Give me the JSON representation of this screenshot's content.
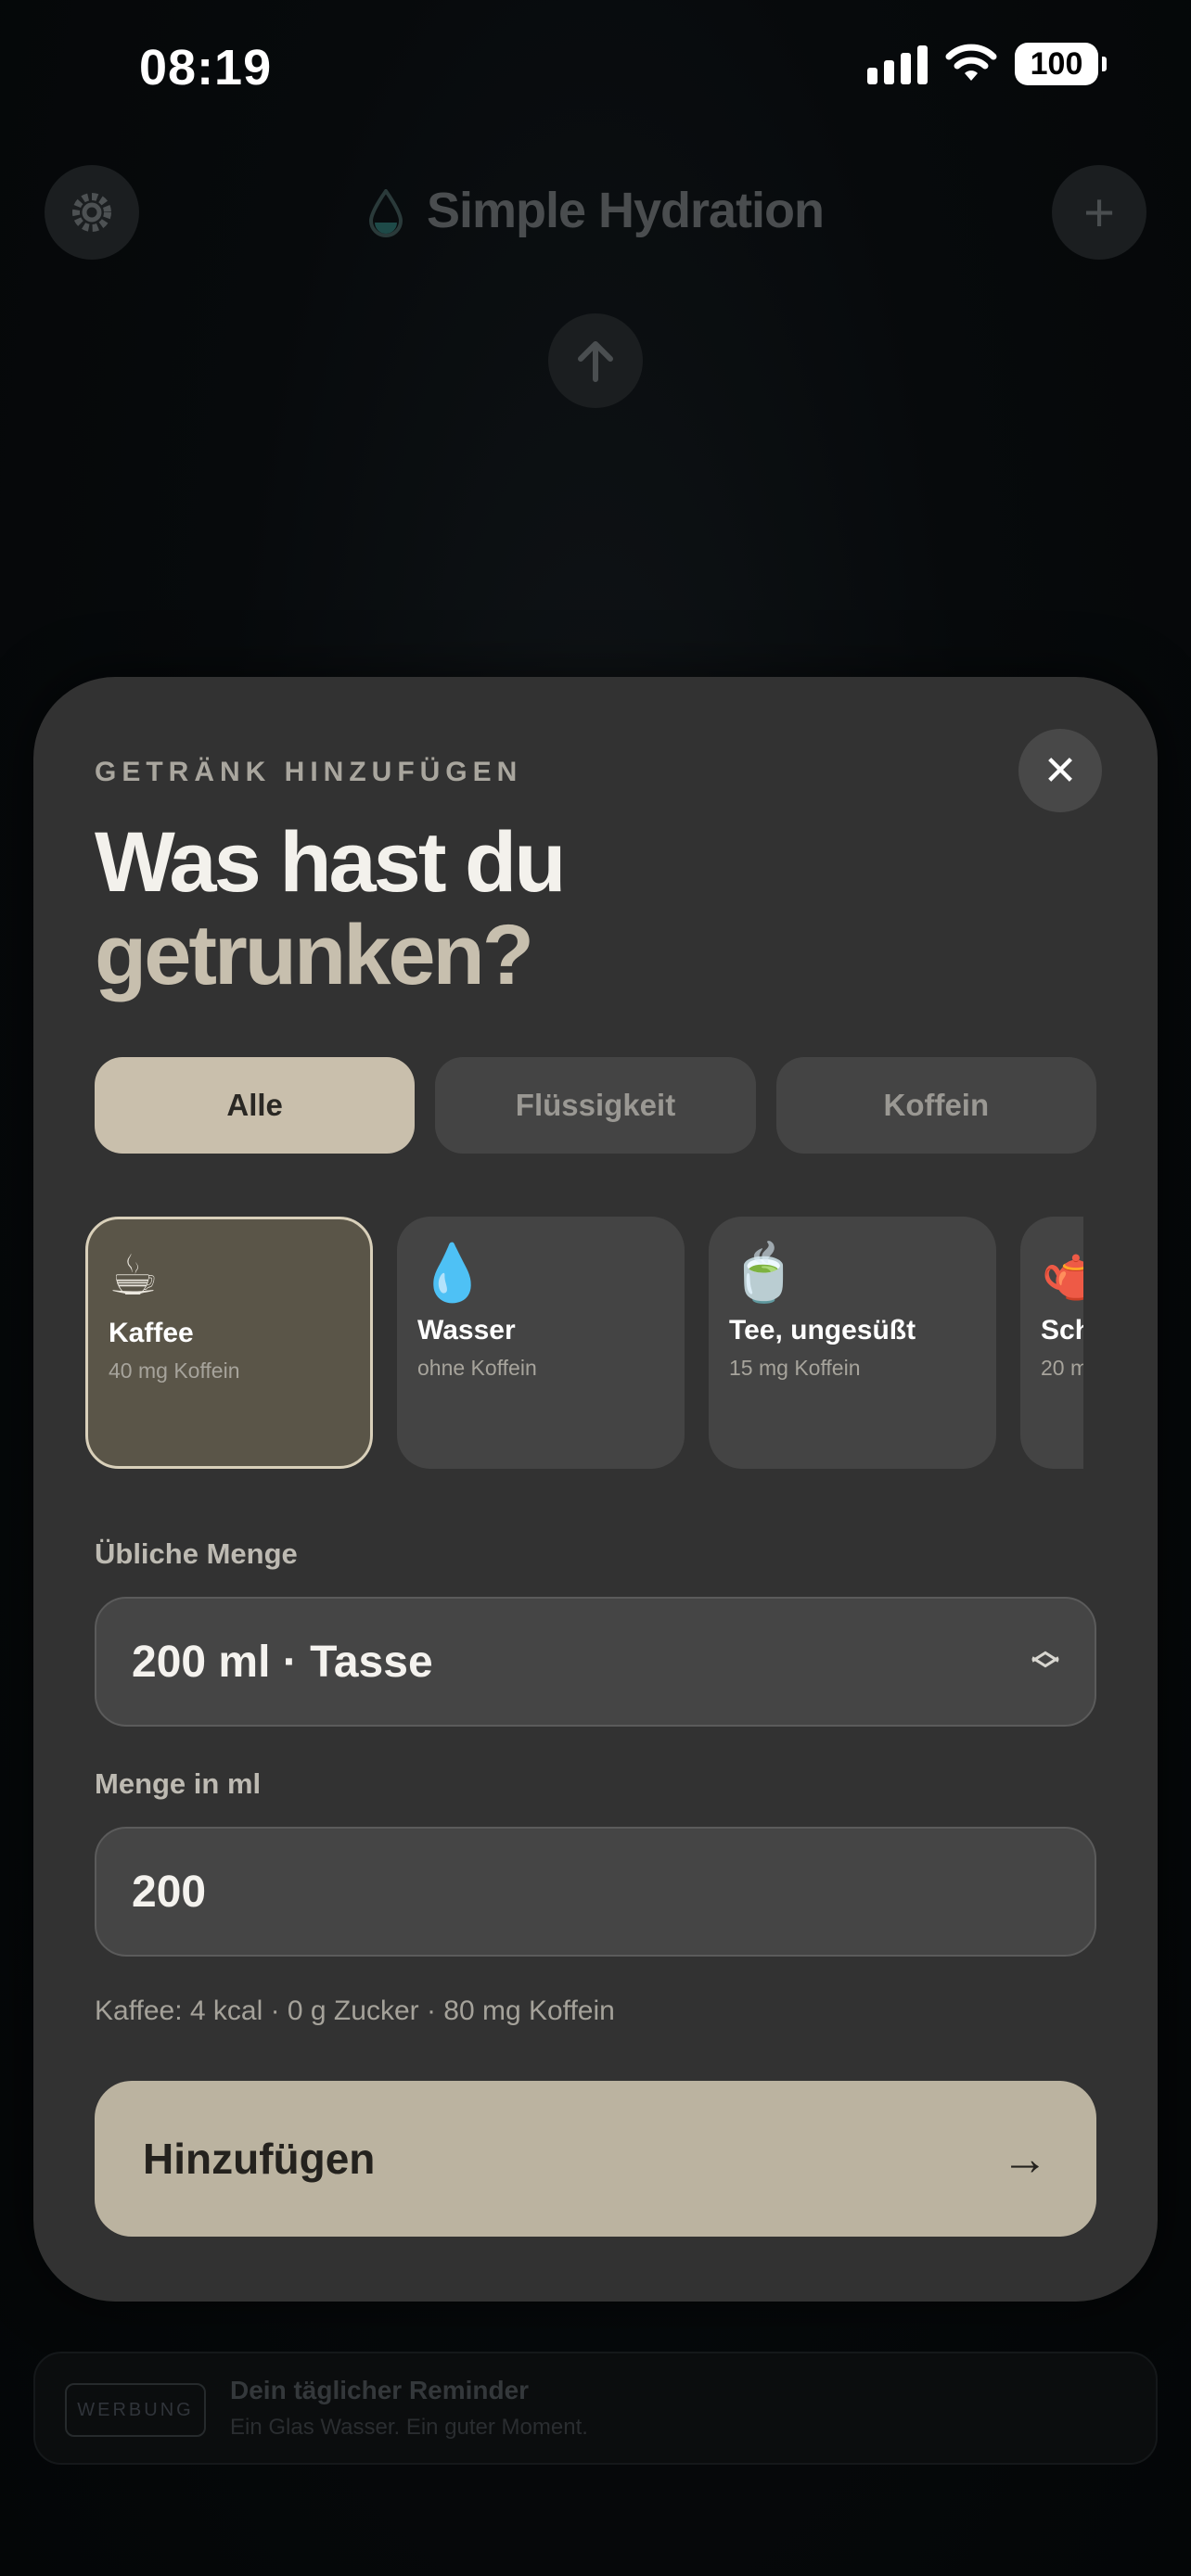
{
  "status_bar": {
    "time": "08:19",
    "battery": "100"
  },
  "header": {
    "title": "Simple Hydration"
  },
  "sheet": {
    "eyebrow": "GETRÄNK HINZUFÜGEN",
    "headline_line1": "Was hast du",
    "headline_line2": "getrunken?",
    "tabs": [
      {
        "label": "Alle",
        "active": true
      },
      {
        "label": "Flüssigkeit",
        "active": false
      },
      {
        "label": "Koffein",
        "active": false
      }
    ],
    "drinks": [
      {
        "emoji": "☕",
        "name": "Kaffee",
        "detail": "40 mg Koffein",
        "selected": true
      },
      {
        "emoji": "💧",
        "name": "Wasser",
        "detail": "ohne Koffein",
        "selected": false
      },
      {
        "emoji": "🍵",
        "name": "Tee, ungesüßt",
        "detail": "15 mg Koffein",
        "selected": false
      },
      {
        "emoji": "🫖",
        "name": "Sch",
        "detail": "20 m",
        "selected": false
      }
    ],
    "usual_amount_label": "Übliche Menge",
    "usual_amount_value": "200 ml · Tasse",
    "amount_label": "Menge in ml",
    "amount_value": "200",
    "nutrition_hint": "Kaffee: 4 kcal · 0 g Zucker · 80 mg Koffein",
    "add_button_label": "Hinzufügen",
    "add_button_arrow": "→"
  },
  "ad": {
    "badge": "WERBUNG",
    "title": "Dein täglicher Reminder",
    "subtitle": "Ein Glas Wasser. Ein guter Moment."
  },
  "colors": {
    "accent": "#c9bfac",
    "sheet_bg": "#323232",
    "cta_bg": "#bbb3a0"
  }
}
